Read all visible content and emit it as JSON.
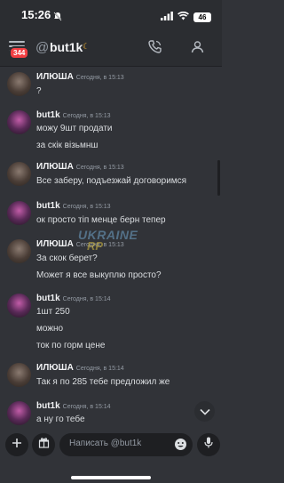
{
  "status": {
    "time": "15:26",
    "battery": "46"
  },
  "header": {
    "unread": "344",
    "title": "but1k"
  },
  "messages": [
    {
      "author": "ИЛЮША",
      "timestamp": "Сегодня, в 15:13",
      "lines": [
        "?"
      ]
    },
    {
      "author": "but1k",
      "timestamp": "Сегодня, в 15:13",
      "lines": [
        "можу 9шт продати",
        "за скік візьмнш"
      ]
    },
    {
      "author": "ИЛЮША",
      "timestamp": "Сегодня, в 15:13",
      "lines": [
        "Все заберу, подъезжай договоримся"
      ]
    },
    {
      "author": "but1k",
      "timestamp": "Сегодня, в 15:13",
      "lines": [
        "ок просто тіп менце берн тепер"
      ]
    },
    {
      "author": "ИЛЮША",
      "timestamp": "Сегодня, в 15:13",
      "lines": [
        "За скок берет?",
        "Может я все выкуплю просто?"
      ]
    },
    {
      "author": "but1k",
      "timestamp": "Сегодня, в 15:14",
      "lines": [
        "1шт 250",
        "можно",
        "ток по горм цене"
      ]
    },
    {
      "author": "ИЛЮША",
      "timestamp": "Сегодня, в 15:14",
      "lines": [
        "Так я по 285 тебе предложил же"
      ]
    },
    {
      "author": "but1k",
      "timestamp": "Сегодня, в 15:14",
      "lines": [
        "а ну го тебе"
      ]
    }
  ],
  "watermark": {
    "line1": "UKRAINE",
    "line2": "RP"
  },
  "composer": {
    "placeholder": "Написать @but1k"
  },
  "icons": [
    "bell-slash-icon",
    "signal-icon",
    "wifi-icon",
    "battery-icon",
    "menu-icon",
    "call-icon",
    "profile-icon",
    "chevron-down-icon",
    "plus-icon",
    "gift-icon",
    "emoji-icon",
    "microphone-icon"
  ]
}
